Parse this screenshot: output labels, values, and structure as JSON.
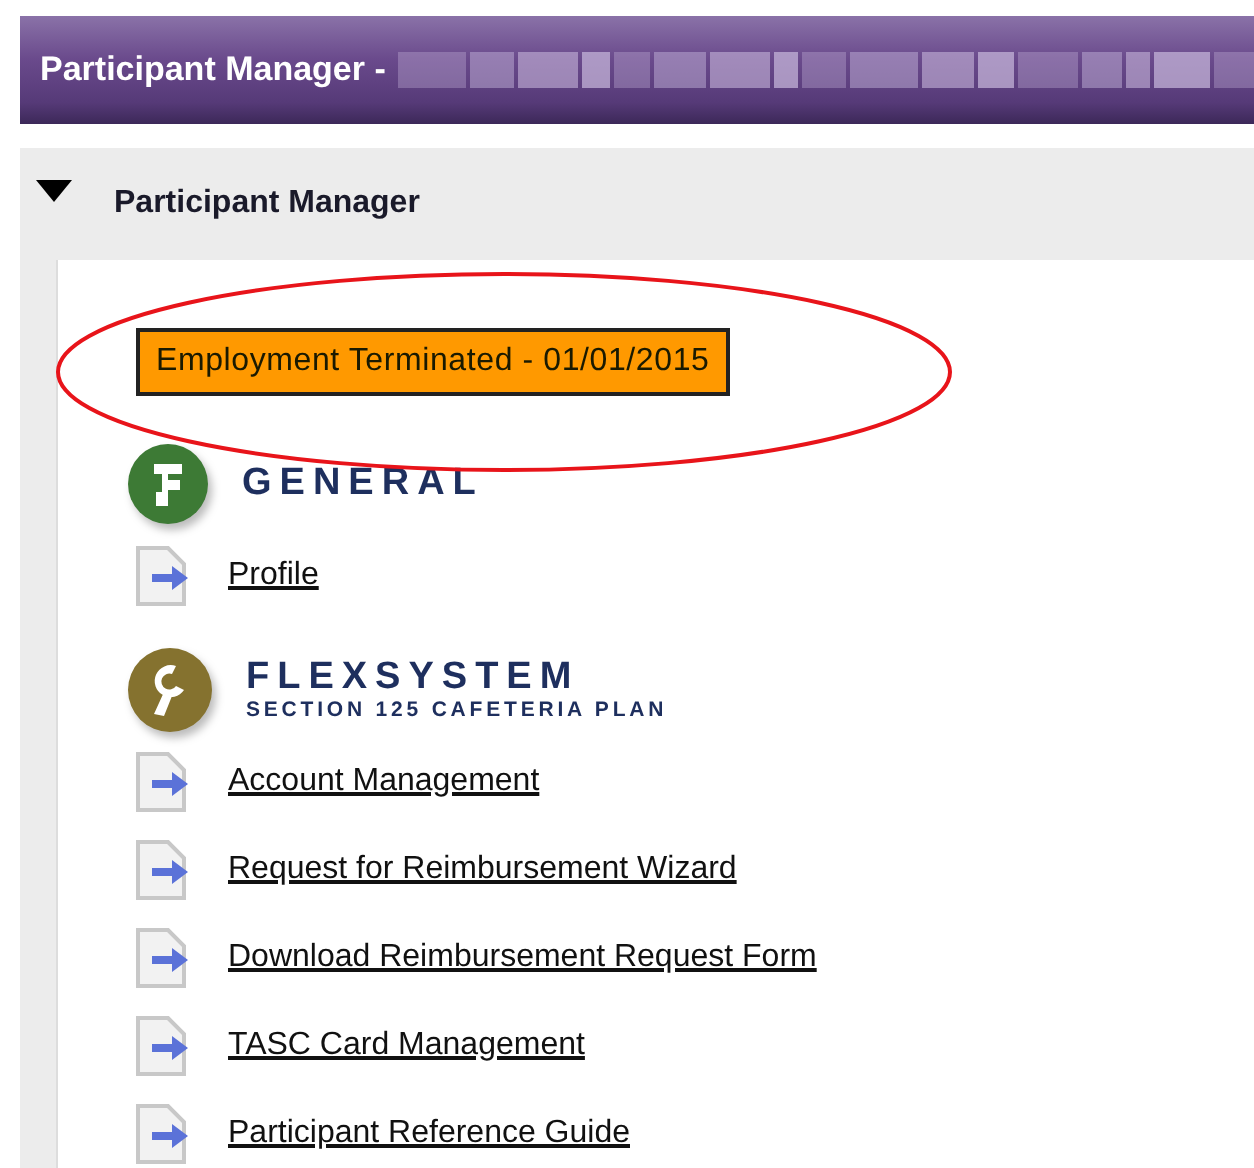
{
  "header": {
    "title": "Participant Manager -",
    "redacted": true
  },
  "panel": {
    "title": "Participant Manager",
    "expanded": true,
    "status_badge": {
      "text": "Employment Terminated - 01/01/2015",
      "circled": true
    },
    "sections": [
      {
        "kind": "general",
        "title": "GENERAL",
        "links": [
          "Profile"
        ]
      },
      {
        "kind": "flex",
        "title": "FLEXSYSTEM",
        "subtitle": "SECTION 125 CAFETERIA PLAN",
        "links": [
          "Account Management",
          "Request for Reimbursement Wizard",
          "Download Reimbursement Request Form",
          "TASC Card Management",
          "Participant Reference Guide"
        ]
      }
    ]
  }
}
